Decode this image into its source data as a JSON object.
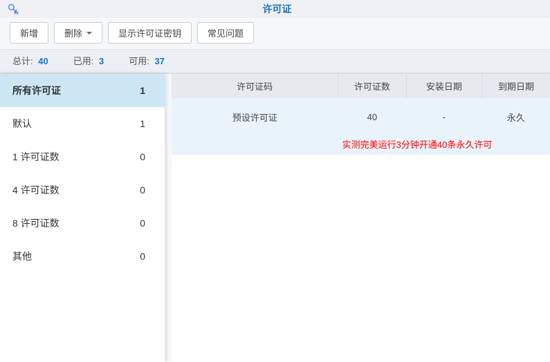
{
  "title": "许可证",
  "toolbar": {
    "add": "新增",
    "delete": "删除",
    "showKey": "显示许可证密钥",
    "faq": "常见问题"
  },
  "stats": {
    "totalLabel": "总计:",
    "totalValue": "40",
    "usedLabel": "已用:",
    "usedValue": "3",
    "availLabel": "可用:",
    "availValue": "37"
  },
  "sidebar": [
    {
      "label": "所有许可证",
      "count": "1",
      "active": true
    },
    {
      "label": "默认",
      "count": "1",
      "active": false
    },
    {
      "label": "1 许可证数",
      "count": "0",
      "active": false
    },
    {
      "label": "4 许可证数",
      "count": "0",
      "active": false
    },
    {
      "label": "8 许可证数",
      "count": "0",
      "active": false
    },
    {
      "label": "其他",
      "count": "0",
      "active": false
    }
  ],
  "table": {
    "headers": {
      "code": "许可证码",
      "count": "许可证数",
      "install": "安装日期",
      "expire": "到期日期"
    },
    "row": {
      "code": "预设许可证",
      "count": "40",
      "install": "-",
      "expire": "永久"
    },
    "note": "实测完美运行3分钟开通40条永久许可"
  }
}
